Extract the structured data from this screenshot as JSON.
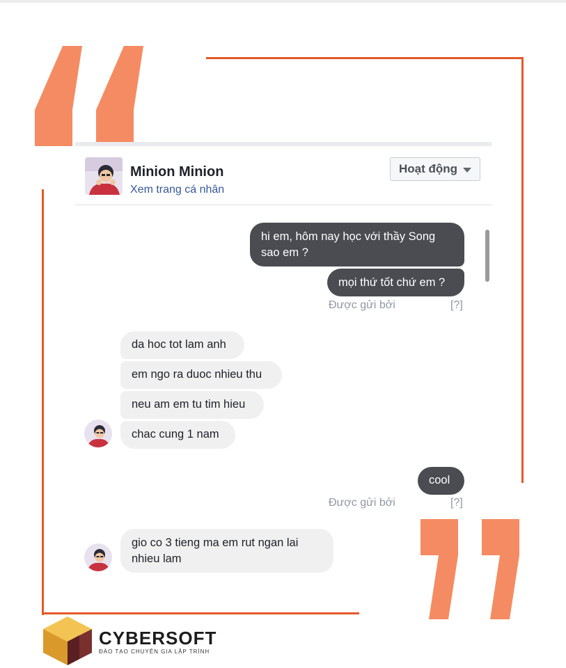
{
  "chat": {
    "contact_name": "Minion Minion",
    "profile_link": "Xem trang cá nhân",
    "status_button": "Hoạt động",
    "sent_messages_1": [
      "hi em, hôm nay học với thầy Song sao em ?",
      "mọi thứ tốt chứ em ?"
    ],
    "sent_by_1": "Được gửi bởi",
    "help_1": "[?]",
    "received_messages_1": [
      "da hoc tot lam anh",
      "em ngo ra duoc nhieu thu",
      "neu am em tu tim hieu",
      "chac cung 1 nam"
    ],
    "sent_messages_2": [
      "cool"
    ],
    "sent_by_2": "Được gửi bởi",
    "help_2": "[?]",
    "received_messages_2": [
      "gio co 3 tieng ma em rut ngan lai nhieu lam"
    ]
  },
  "brand": {
    "name": "CYBERSOFT",
    "tagline": "ĐÀO TẠO CHUYÊN GIA LẬP TRÌNH"
  },
  "colors": {
    "frame": "#e5582a",
    "quote": "#f58b62",
    "outgoing_bubble": "#4a4c52",
    "incoming_bubble": "#f1f0f0",
    "link": "#365899"
  },
  "icons": [
    "open-quote-icon",
    "close-quote-icon",
    "dropdown-caret-icon",
    "avatar",
    "cybersoft-cube-logo"
  ]
}
